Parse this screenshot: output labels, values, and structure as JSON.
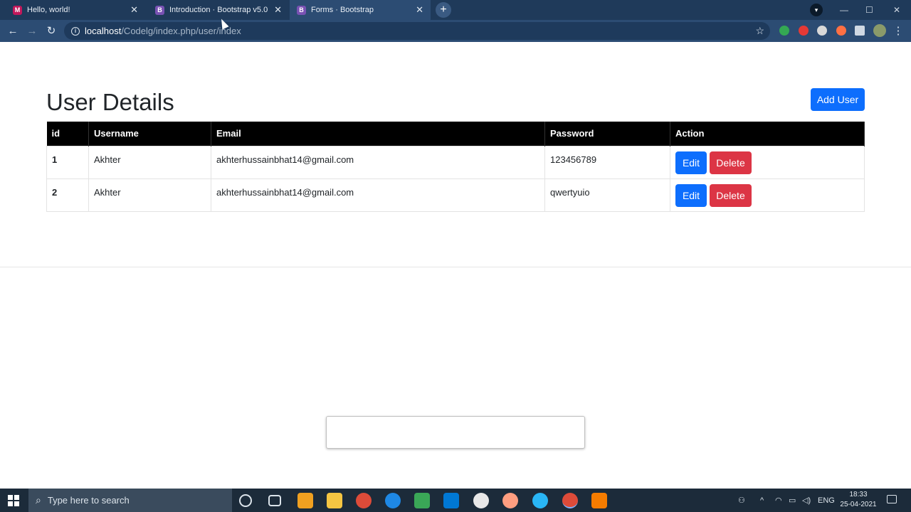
{
  "browser": {
    "tabs": [
      {
        "title": "Hello, world!",
        "favicon": "M",
        "color": "#c2185b"
      },
      {
        "title": "Introduction · Bootstrap v5.0",
        "favicon": "B",
        "color": "#7952b3"
      },
      {
        "title": "Forms · Bootstrap",
        "favicon": "B",
        "color": "#7952b3"
      }
    ],
    "new_tab": "+",
    "address": {
      "host": "localhost",
      "path": "/Codelg/index.php/user/index"
    }
  },
  "page": {
    "title": "User Details",
    "add_button": "Add User",
    "table": {
      "headers": [
        "id",
        "Username",
        "Email",
        "Password",
        "Action"
      ],
      "rows": [
        {
          "id": "1",
          "username": "Akhter",
          "email": "akhterhussainbhat14@gmail.com",
          "password": "123456789"
        },
        {
          "id": "2",
          "username": "Akhter",
          "email": "akhterhussainbhat14@gmail.com",
          "password": "qwertyuio"
        }
      ],
      "edit_label": "Edit",
      "delete_label": "Delete"
    }
  },
  "taskbar": {
    "search_placeholder": "Type here to search",
    "language": "ENG",
    "time": "18:33",
    "date": "25-04-2021"
  },
  "colors": {
    "primary": "#0d6efd",
    "danger": "#dc3545",
    "tabbar": "#1f3a5a",
    "toolbar": "#2c4c73"
  }
}
